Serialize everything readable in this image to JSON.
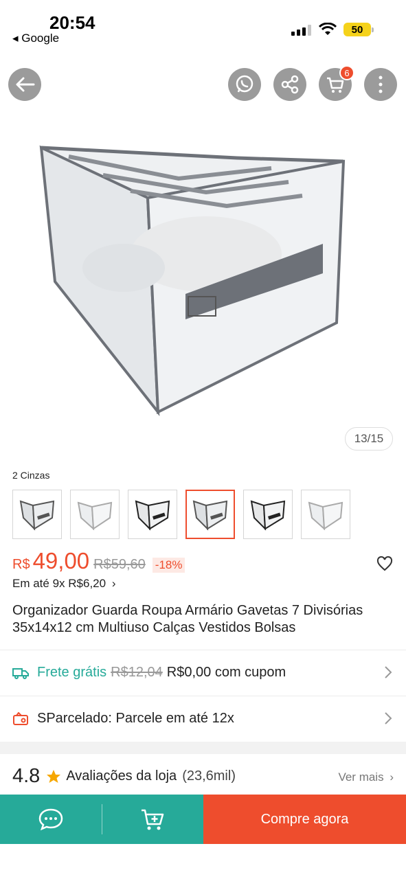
{
  "status_bar": {
    "time": "20:54",
    "back_app": "◂ Google",
    "battery": "50"
  },
  "nav": {
    "cart_count": "6"
  },
  "gallery": {
    "counter": "13/15"
  },
  "variant": {
    "label": "2 Cinzas",
    "thumbnails": 6,
    "selected_index": 3
  },
  "price": {
    "currency": "R$",
    "current": "49,00",
    "original": "R$59,60",
    "discount": "-18%"
  },
  "installment": "Em até 9x R$6,20",
  "product_title": "Organizador Guarda Roupa Armário Gavetas 7 Divisórias 35x14x12 cm Multiuso Calças Vestidos Bolsas",
  "shipping": {
    "label": "Frete grátis",
    "old": "R$12,04",
    "new": "R$0,00 com cupom"
  },
  "sparcelado": "SParcelado: Parcele em até 12x",
  "store_rating": {
    "score": "4.8",
    "label": "Avaliações da loja",
    "count": "(23,6mil)",
    "see_more": "Ver mais"
  },
  "bottom": {
    "buy_label": "Compre agora"
  },
  "colors": {
    "accent": "#ee4d2d",
    "teal": "#26aa99"
  }
}
